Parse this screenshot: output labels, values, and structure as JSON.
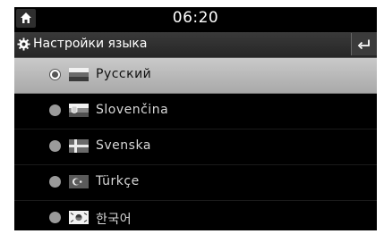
{
  "status": {
    "time": "06:20",
    "home_icon": "home-icon"
  },
  "header": {
    "title": "Настройки языка",
    "settings_icon": "gear-icon",
    "back_icon": "back-arrow-icon"
  },
  "languages": [
    {
      "label": "Русский",
      "flag": "russia-flag-icon",
      "selected": true
    },
    {
      "label": "Slovenčina",
      "flag": "slovakia-flag-icon",
      "selected": false
    },
    {
      "label": "Svenska",
      "flag": "sweden-flag-icon",
      "selected": false
    },
    {
      "label": "Türkçe",
      "flag": "turkey-flag-icon",
      "selected": false
    },
    {
      "label": "한국어",
      "flag": "korea-flag-icon",
      "selected": false
    }
  ],
  "colors": {
    "background": "#000000",
    "selected_row": "#b8b8b8",
    "text": "#d8d8d8"
  }
}
